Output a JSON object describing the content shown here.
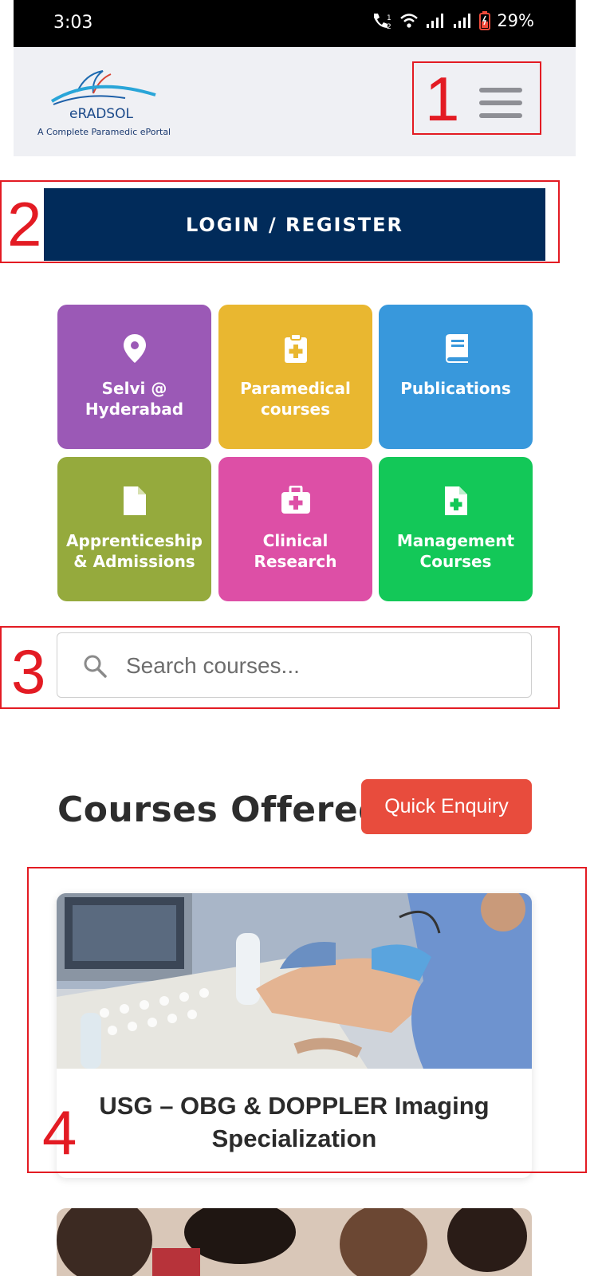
{
  "status_bar": {
    "time": "3:03",
    "battery_percent": "29%",
    "icons": [
      "call-volte-icon",
      "wifi-icon",
      "signal-icon",
      "signal-icon",
      "battery-low-icon"
    ]
  },
  "header": {
    "logo_name": "eRADSOL",
    "logo_tagline": "A Complete Paramedic ePortal",
    "menu_icon": "hamburger-menu-icon"
  },
  "login": {
    "label": "LOGIN / REGISTER"
  },
  "tiles": [
    {
      "label_line1": "Selvi @",
      "label_line2": "Hyderabad",
      "icon": "map-pin-icon",
      "color": "#9b59b6"
    },
    {
      "label_line1": "Paramedical",
      "label_line2": "courses",
      "icon": "clipboard-plus-icon",
      "color": "#e9b730"
    },
    {
      "label_line1": "Publications",
      "label_line2": "",
      "icon": "book-icon",
      "color": "#3898dc"
    },
    {
      "label_line1": "Apprenticeship",
      "label_line2": "& Admissions",
      "icon": "document-icon",
      "color": "#95aa3d"
    },
    {
      "label_line1": "Clinical",
      "label_line2": "Research",
      "icon": "medical-kit-icon",
      "color": "#dd4fa6"
    },
    {
      "label_line1": "Management",
      "label_line2": "Courses",
      "icon": "file-medical-icon",
      "color": "#13c858"
    }
  ],
  "search": {
    "placeholder": "Search courses...",
    "value": ""
  },
  "courses": {
    "heading": "Courses Offered",
    "enquiry_label": "Quick Enquiry",
    "items": [
      {
        "title": "USG – OBG & DOPPLER Imaging Specialization"
      }
    ]
  },
  "annotations": [
    "1",
    "2",
    "3",
    "4"
  ],
  "colors": {
    "accent_navy": "#012b5a",
    "enquiry_red": "#e84c3d",
    "annotation_red": "#e31b23",
    "header_bg": "#eff0f4"
  }
}
